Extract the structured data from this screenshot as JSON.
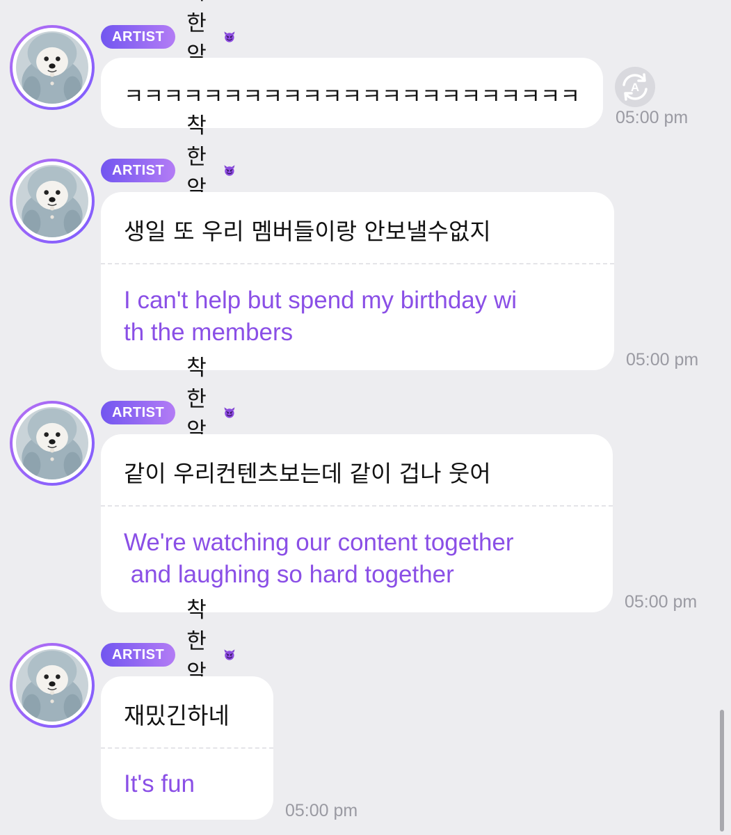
{
  "colors": {
    "accent_purple": "#8a4fe6",
    "badge_start": "#7256f0",
    "badge_end": "#b37cf5",
    "background": "#ededf0",
    "bubble": "#ffffff",
    "timestamp": "#9a9aa2"
  },
  "translate_icon": "translate-refresh-icon",
  "messages": [
    {
      "badge": "ARTIST",
      "author": "착한악마",
      "text": "ㅋㅋㅋㅋㅋㅋㅋㅋㅋㅋㅋㅋㅋㅋㅋㅋㅋㅋㅋㅋㅋㅋㅋ",
      "time": "05:00 pm"
    },
    {
      "badge": "ARTIST",
      "author": "착한악마",
      "text": "생일 또 우리 멤버들이랑 안보낼수없지",
      "translation": "I can't help but spend my birthday wi\nth the members",
      "time": "05:00 pm"
    },
    {
      "badge": "ARTIST",
      "author": "착한악마",
      "text": "같이 우리컨텐츠보는데 같이 겁나 웃어",
      "translation": "We're watching our content together\n and laughing so hard together",
      "time": "05:00 pm"
    },
    {
      "badge": "ARTIST",
      "author": "착한악마",
      "text": "재밌긴하네",
      "translation": "It's fun",
      "time": "05:00 pm"
    }
  ]
}
